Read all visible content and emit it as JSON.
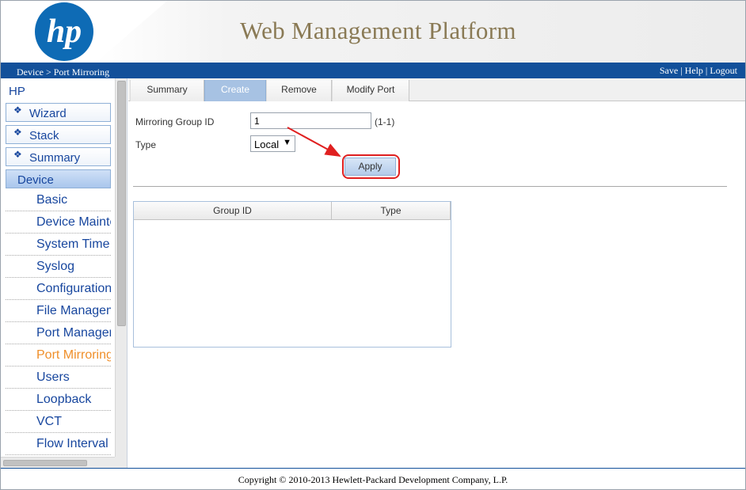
{
  "header": {
    "logo_text": "hp",
    "title": "Web Management Platform"
  },
  "topbar": {
    "breadcrumb": "Device > Port Mirroring",
    "links": {
      "save": "Save",
      "help": "Help",
      "logout": "Logout",
      "separator": " | "
    }
  },
  "sidebar": {
    "root": "HP",
    "groups": [
      {
        "label": "Wizard",
        "icon": "diamond-bullet-icon"
      },
      {
        "label": "Stack",
        "icon": "diamond-bullet-icon"
      },
      {
        "label": "Summary",
        "icon": "diamond-bullet-icon"
      },
      {
        "label": "Device"
      }
    ],
    "items": [
      {
        "label": "Basic"
      },
      {
        "label": "Device Maintenance"
      },
      {
        "label": "System Time"
      },
      {
        "label": "Syslog"
      },
      {
        "label": "Configuration"
      },
      {
        "label": "File Management"
      },
      {
        "label": "Port Management"
      },
      {
        "label": "Port Mirroring"
      },
      {
        "label": "Users"
      },
      {
        "label": "Loopback"
      },
      {
        "label": "VCT"
      },
      {
        "label": "Flow Interval"
      }
    ]
  },
  "tabs": [
    {
      "label": "Summary"
    },
    {
      "label": "Create"
    },
    {
      "label": "Remove"
    },
    {
      "label": "Modify Port"
    }
  ],
  "form": {
    "group_id_label": "Mirroring Group ID",
    "group_id_value": "1",
    "group_id_range": "(1-1)",
    "type_label": "Type",
    "type_value": "Local",
    "apply_label": "Apply"
  },
  "grid": {
    "columns": [
      "Group ID",
      "Type"
    ],
    "rows": []
  },
  "footer": {
    "copyright": "Copyright © 2010-2013 Hewlett-Packard Development Company, L.P."
  },
  "colors": {
    "brand_blue": "#12509a",
    "link_blue": "#17469e",
    "current_item": "#ef8f2a",
    "highlight_red": "#e02020",
    "title_gold": "#8a7a55"
  }
}
